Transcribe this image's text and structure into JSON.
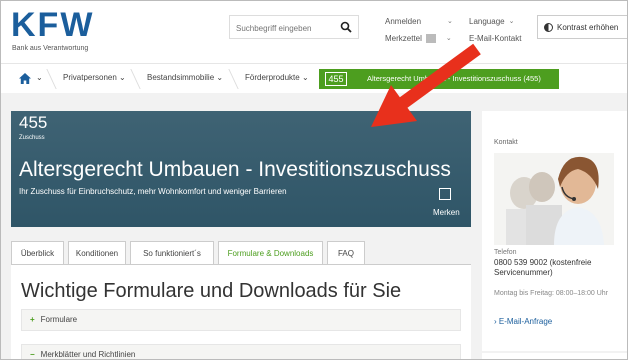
{
  "header": {
    "logo": "KFW",
    "tagline": "Bank aus Verantwortung",
    "search_placeholder": "Suchbegriff eingeben",
    "login": "Anmelden",
    "notepad": "Merkzettel",
    "language": "Language",
    "email_contact": "E-Mail-Kontakt",
    "contrast": "Kontrast erhöhen"
  },
  "breadcrumb": {
    "items": [
      "Privatpersonen",
      "Bestandsimmobilie",
      "Förderprodukte"
    ],
    "current_number": "455",
    "current_label": "Altersgerecht Umbauen - Investitionszuschuss (455)"
  },
  "banner": {
    "number": "455",
    "type": "Zuschuss",
    "title": "Altersgerecht Umbauen - Investitionszuschuss",
    "subtitle": "Ihr Zuschuss für Einbruchschutz, mehr Wohnkomfort und weniger Barrieren",
    "save_label": "Merken"
  },
  "tabs": [
    "Überblick",
    "Konditionen",
    "So funktioniert´s",
    "Formulare & Downloads",
    "FAQ"
  ],
  "content": {
    "title": "Wichtige Formulare und Downloads für Sie",
    "accordion": [
      {
        "sign": "+",
        "label": "Formulare"
      },
      {
        "sign": "−",
        "label": "Merkblätter und Richtlinien"
      }
    ]
  },
  "sidebar": {
    "contact_label": "Kontakt",
    "phone_label": "Telefon",
    "phone": "0800 539 9002 (kostenfreie Servicenummer)",
    "hours": "Montag bis Freitag: 08:00–18:00 Uhr",
    "email_link": "› E-Mail-Anfrage"
  },
  "colors": {
    "brand_blue": "#1b5e9c",
    "accent_green": "#4d9e1f",
    "banner_bg": "#35596b",
    "annotation_red": "#e8301c"
  }
}
